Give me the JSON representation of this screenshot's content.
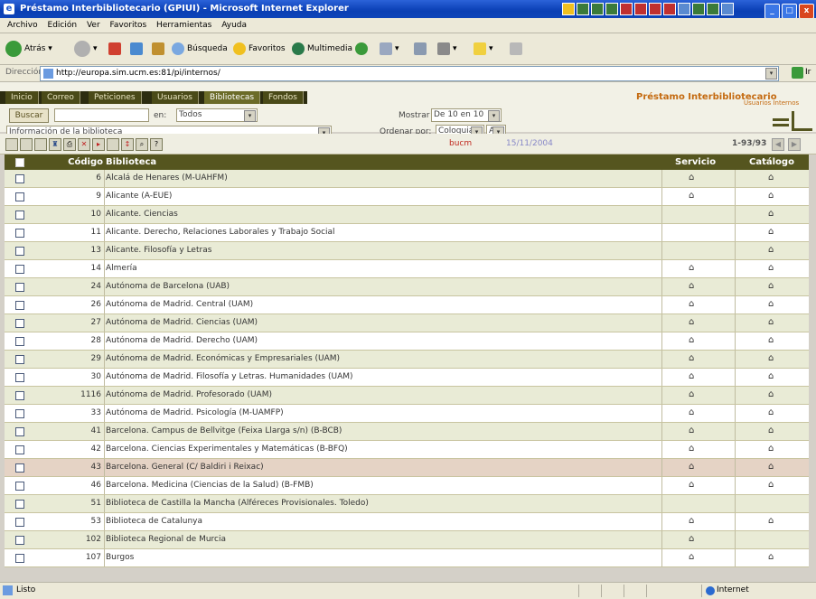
{
  "window": {
    "title": "Préstamo Interbibliotecario (GPIUI) - Microsoft Internet Explorer",
    "controls": [
      "_",
      "□",
      "x"
    ]
  },
  "menu": [
    "Archivo",
    "Edición",
    "Ver",
    "Favoritos",
    "Herramientas",
    "Ayuda"
  ],
  "toolbar": {
    "back": "Atrás",
    "search": "Búsqueda",
    "favorites": "Favoritos",
    "multimedia": "Multimedia"
  },
  "address": {
    "label": "Dirección",
    "url": "http://europa.sim.ucm.es:81/pi/internos/",
    "go": "Ir"
  },
  "app": {
    "tabs": [
      "Inicio",
      "Correo",
      "Peticiones",
      "Usuarios",
      "Bibliotecas",
      "Fondos"
    ],
    "active_tab": "Bibliotecas",
    "title": "Préstamo Interbibliotecario",
    "subtitle": "Usuarios Internos",
    "search_button": "Buscar",
    "search_value": "",
    "en_label": "en:",
    "en_value": "Todos",
    "info_value": "Información de la biblioteca",
    "mostrar_label": "Mostrar",
    "mostrar_value": "De 10 en 10",
    "ordenar_label": "Ordenar por:",
    "ordenar_value": "Coloquial",
    "ordenar_dir": "A",
    "user": "bucm",
    "date": "15/11/2004",
    "pages": "1-93/93"
  },
  "table": {
    "headers": {
      "codigo": "Código",
      "biblioteca": "Biblioteca",
      "servicio": "Servicio",
      "catalogo": "Catálogo"
    },
    "rows": [
      {
        "codigo": "6",
        "biblioteca": "Alcalá de Henares (M-UAHFM)",
        "servicio": true,
        "catalogo": true
      },
      {
        "codigo": "9",
        "biblioteca": "Alicante (A-EUE)",
        "servicio": true,
        "catalogo": true
      },
      {
        "codigo": "10",
        "biblioteca": "Alicante. Ciencias",
        "servicio": false,
        "catalogo": true
      },
      {
        "codigo": "11",
        "biblioteca": "Alicante. Derecho, Relaciones Laborales y Trabajo Social",
        "servicio": false,
        "catalogo": true
      },
      {
        "codigo": "13",
        "biblioteca": "Alicante. Filosofía y Letras",
        "servicio": false,
        "catalogo": true
      },
      {
        "codigo": "14",
        "biblioteca": "Almería",
        "servicio": true,
        "catalogo": true
      },
      {
        "codigo": "24",
        "biblioteca": "Autónoma de Barcelona (UAB)",
        "servicio": true,
        "catalogo": true
      },
      {
        "codigo": "26",
        "biblioteca": "Autónoma de Madrid. Central (UAM)",
        "servicio": true,
        "catalogo": true
      },
      {
        "codigo": "27",
        "biblioteca": "Autónoma de Madrid. Ciencias (UAM)",
        "servicio": true,
        "catalogo": true
      },
      {
        "codigo": "28",
        "biblioteca": "Autónoma de Madrid. Derecho (UAM)",
        "servicio": true,
        "catalogo": true
      },
      {
        "codigo": "29",
        "biblioteca": "Autónoma de Madrid. Económicas y Empresariales (UAM)",
        "servicio": true,
        "catalogo": true
      },
      {
        "codigo": "30",
        "biblioteca": "Autónoma de Madrid. Filosofía y Letras. Humanidades (UAM)",
        "servicio": true,
        "catalogo": true
      },
      {
        "codigo": "1116",
        "biblioteca": "Autónoma de Madrid. Profesorado (UAM)",
        "servicio": true,
        "catalogo": true
      },
      {
        "codigo": "33",
        "biblioteca": "Autónoma de Madrid. Psicología (M-UAMFP)",
        "servicio": true,
        "catalogo": true
      },
      {
        "codigo": "41",
        "biblioteca": "Barcelona. Campus de Bellvitge (Feixa Llarga s/n) (B-BCB)",
        "servicio": true,
        "catalogo": true
      },
      {
        "codigo": "42",
        "biblioteca": "Barcelona. Ciencias Experimentales y Matemáticas (B-BFQ)",
        "servicio": true,
        "catalogo": true
      },
      {
        "codigo": "43",
        "biblioteca": "Barcelona. General (C/ Baldiri i Reixac)",
        "servicio": true,
        "catalogo": true
      },
      {
        "codigo": "46",
        "biblioteca": "Barcelona. Medicina (Ciencias de la Salud) (B-FMB)",
        "servicio": true,
        "catalogo": true
      },
      {
        "codigo": "51",
        "biblioteca": "Biblioteca de Castilla la Mancha (Alféreces Provisionales. Toledo)",
        "servicio": false,
        "catalogo": false
      },
      {
        "codigo": "53",
        "biblioteca": "Biblioteca de Catalunya",
        "servicio": true,
        "catalogo": true
      },
      {
        "codigo": "102",
        "biblioteca": "Biblioteca Regional de Murcia",
        "servicio": true,
        "catalogo": false
      },
      {
        "codigo": "107",
        "biblioteca": "Burgos",
        "servicio": true,
        "catalogo": true
      }
    ]
  },
  "status": {
    "text": "Listo",
    "zone": "Internet"
  }
}
